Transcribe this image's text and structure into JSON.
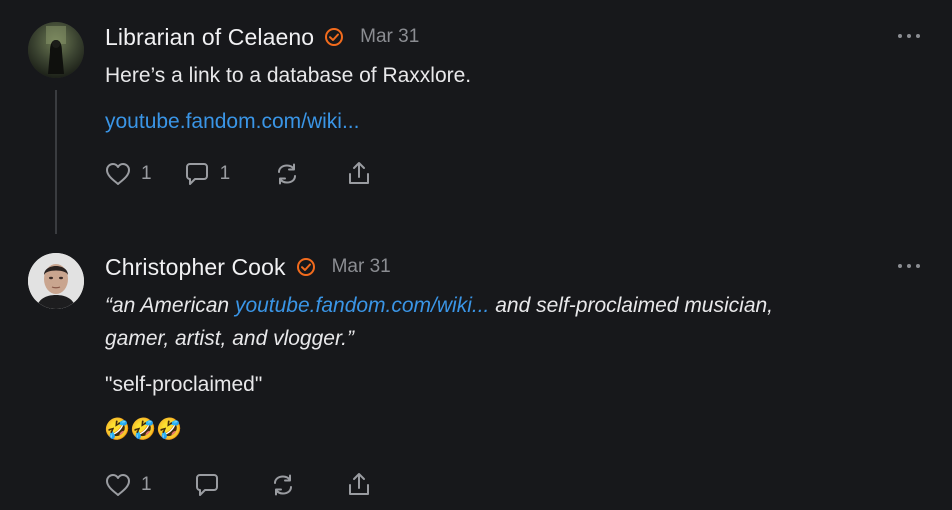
{
  "posts": [
    {
      "author": "Librarian of Celaeno",
      "date": "Mar 31",
      "text": "Here’s a link to a database of Raxxlore.",
      "link": "youtube.fandom.com/wiki...",
      "likes": "1",
      "replies": "1"
    },
    {
      "author": "Christopher Cook",
      "date": "Mar 31",
      "quote_open": "“an American ",
      "quote_link": "youtube.fandom.com/wiki...",
      "quote_rest_line1": " and self-proclaimed musician,",
      "quote_line2": "gamer, artist, and vlogger.”",
      "text": "\"self-proclaimed\"",
      "emojis": "🤣🤣🤣",
      "likes": "1"
    }
  ],
  "colors": {
    "accent_link": "#3a95e6",
    "verified": "#f26b1d",
    "background": "#17181b"
  },
  "icons": [
    "verified-badge-icon",
    "more-icon",
    "heart-icon",
    "comment-icon",
    "restack-icon",
    "share-icon"
  ]
}
